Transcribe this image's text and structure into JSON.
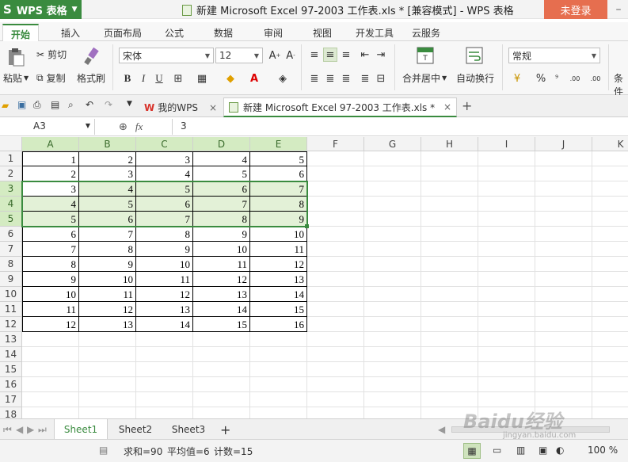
{
  "app": {
    "name": "WPS 表格",
    "logo": "S"
  },
  "window": {
    "title": "新建 Microsoft Excel 97-2003 工作表.xls * [兼容模式] - WPS 表格",
    "login_label": "未登录"
  },
  "menu_tabs": [
    "开始",
    "插入",
    "页面布局",
    "公式",
    "数据",
    "审阅",
    "视图",
    "开发工具",
    "云服务"
  ],
  "ribbon": {
    "paste": "粘贴",
    "cut": "剪切",
    "copy": "复制",
    "format_painter": "格式刷",
    "font_name": "宋体",
    "font_size": "12",
    "bold": "B",
    "italic": "I",
    "underline": "U",
    "merge_center": "合并居中",
    "wrap_text": "自动换行",
    "number_format": "常规",
    "percent": "%",
    "comma": "⁹",
    "increase_decimal": ".00",
    "decrease_decimal": ".00",
    "conditional": "条件"
  },
  "doc_tabs": {
    "my_wps": "我的WPS",
    "active_doc": "新建 Microsoft Excel 97-2003 工作表.xls *"
  },
  "formula_bar": {
    "name_box": "A3",
    "fx": "fx",
    "value": "3"
  },
  "columns": [
    "A",
    "B",
    "C",
    "D",
    "E",
    "F",
    "G",
    "H",
    "I",
    "J",
    "K"
  ],
  "rows": [
    "1",
    "2",
    "3",
    "4",
    "5",
    "6",
    "7",
    "8",
    "9",
    "10",
    "11",
    "12",
    "13",
    "14",
    "15",
    "16",
    "17",
    "18"
  ],
  "cells": [
    [
      1,
      2,
      3,
      4,
      5
    ],
    [
      2,
      3,
      4,
      5,
      6
    ],
    [
      3,
      4,
      5,
      6,
      7
    ],
    [
      4,
      5,
      6,
      7,
      8
    ],
    [
      5,
      6,
      7,
      8,
      9
    ],
    [
      6,
      7,
      8,
      9,
      10
    ],
    [
      7,
      8,
      9,
      10,
      11
    ],
    [
      8,
      9,
      10,
      11,
      12
    ],
    [
      9,
      10,
      11,
      12,
      13
    ],
    [
      10,
      11,
      12,
      13,
      14
    ],
    [
      11,
      12,
      13,
      14,
      15
    ],
    [
      12,
      13,
      14,
      15,
      16
    ]
  ],
  "selection": {
    "rows": [
      3,
      5
    ],
    "cols": [
      "A",
      "E"
    ]
  },
  "sheets": [
    "Sheet1",
    "Sheet2",
    "Sheet3"
  ],
  "active_sheet": "Sheet1",
  "status": {
    "sum": "求和=90",
    "avg": "平均值=6",
    "count": "计数=15",
    "zoom": "100 %"
  },
  "watermark": {
    "text": "Baidu经验",
    "url_text": "jingyan.baidu.com"
  },
  "colors": {
    "accent": "#3a8b3f",
    "login": "#e66e4f",
    "selection_fill": "#e3f1d7"
  }
}
